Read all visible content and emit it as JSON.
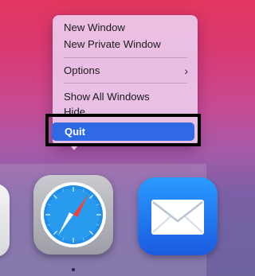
{
  "context_menu": {
    "items": [
      {
        "label": "New Window"
      },
      {
        "label": "New Private Window"
      },
      {
        "label": "Options",
        "submenu_indicator": "›"
      },
      {
        "label": "Show All Windows"
      },
      {
        "label": "Hide"
      },
      {
        "label": "Quit",
        "selected": true
      }
    ]
  },
  "dock": {
    "apps": [
      {
        "icon": "app-icon-partial"
      },
      {
        "icon": "safari-icon",
        "running": true
      },
      {
        "icon": "mail-icon"
      }
    ]
  },
  "colors": {
    "menu_selection": "#2f69e3",
    "highlight_border": "#000000",
    "mail_blue": "#1a7bf5"
  }
}
